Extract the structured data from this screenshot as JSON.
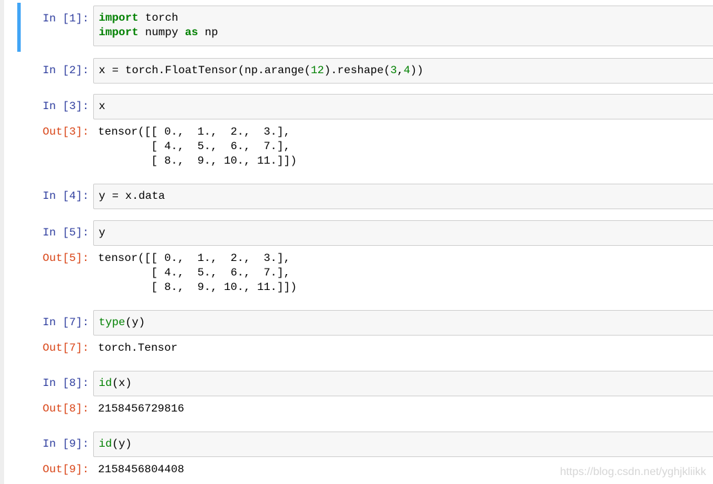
{
  "colors": {
    "prompt_in": "#303f9f",
    "prompt_out": "#d84315",
    "keyword": "#008000",
    "selected_border": "#42a5f5",
    "input_bg": "#f7f7f7"
  },
  "cells": [
    {
      "prompt_in": "In [1]:",
      "code": [
        "import torch",
        "import numpy as np"
      ]
    },
    {
      "prompt_in": "In [2]:",
      "code": [
        "x = torch.FloatTensor(np.arange(12).reshape(3,4))"
      ]
    },
    {
      "prompt_in": "In [3]:",
      "code": [
        "x"
      ],
      "prompt_out": "Out[3]:",
      "output": "tensor([[ 0.,  1.,  2.,  3.],\n        [ 4.,  5.,  6.,  7.],\n        [ 8.,  9., 10., 11.]])"
    },
    {
      "prompt_in": "In [4]:",
      "code": [
        "y = x.data"
      ]
    },
    {
      "prompt_in": "In [5]:",
      "code": [
        "y"
      ],
      "prompt_out": "Out[5]:",
      "output": "tensor([[ 0.,  1.,  2.,  3.],\n        [ 4.,  5.,  6.,  7.],\n        [ 8.,  9., 10., 11.]])"
    },
    {
      "prompt_in": "In [7]:",
      "code": [
        "type(y)"
      ],
      "prompt_out": "Out[7]:",
      "output": "torch.Tensor"
    },
    {
      "prompt_in": "In [8]:",
      "code": [
        "id(x)"
      ],
      "prompt_out": "Out[8]:",
      "output": "2158456729816"
    },
    {
      "prompt_in": "In [9]:",
      "code": [
        "id(y)"
      ],
      "prompt_out": "Out[9]:",
      "output": "2158456804408"
    }
  ],
  "watermark": "https://blog.csdn.net/yghjkliikk"
}
